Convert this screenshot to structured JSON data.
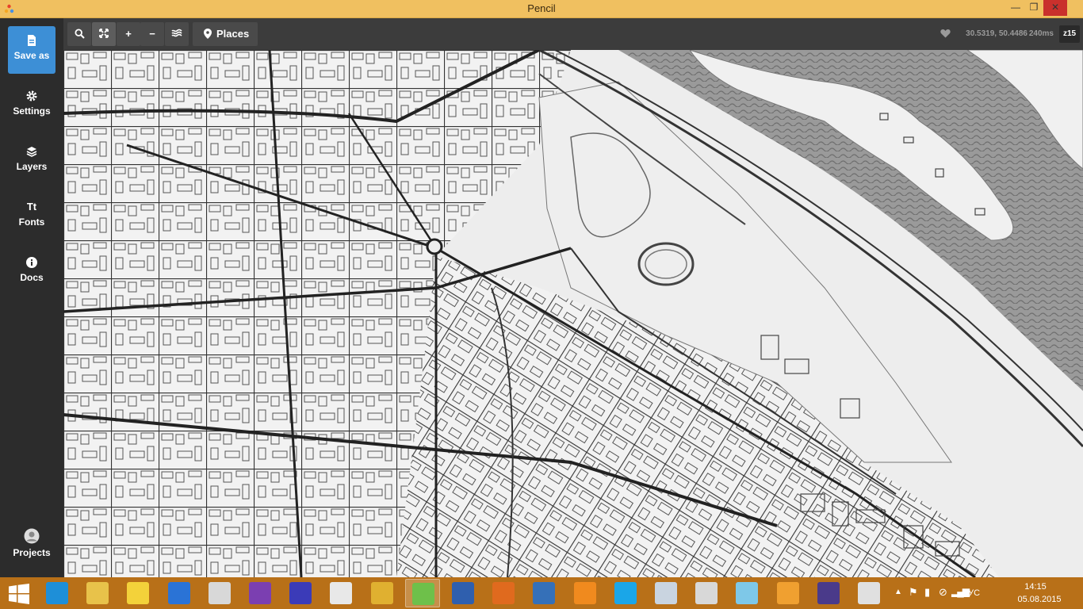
{
  "window": {
    "title": "Pencil",
    "min_glyph": "—",
    "max_glyph": "❐",
    "close_glyph": "✕"
  },
  "sidebar": {
    "items": [
      {
        "label": "Save as",
        "icon": "file-icon"
      },
      {
        "label": "Settings",
        "icon": "gear-icon"
      },
      {
        "label": "Layers",
        "icon": "layers-icon"
      },
      {
        "label": "Fonts",
        "icon": "fonts-icon",
        "glyph": "Tt"
      },
      {
        "label": "Docs",
        "icon": "info-icon"
      }
    ],
    "projects": {
      "label": "Projects",
      "icon": "avatar-icon"
    }
  },
  "toolbar": {
    "search_glyph": "⌕",
    "extent_glyph": "⤢",
    "zoom_in_glyph": "+",
    "zoom_out_glyph": "−",
    "places_label": "Places"
  },
  "status": {
    "coords": "30.5319, 50.4486",
    "render_time": "240ms",
    "zoom": "z15"
  },
  "colors": {
    "titlebar": "#f0c060",
    "sidebar": "#2c2c2c",
    "accent": "#3d8fd6",
    "toolbar": "#3c3c3c",
    "taskbar": "#b87018",
    "map_paper": "#efefef",
    "map_water": "#8a8a8a"
  },
  "taskbar": {
    "apps": [
      {
        "name": "internet-explorer",
        "color": "#1e8fd8"
      },
      {
        "name": "file-explorer",
        "color": "#e8c24a"
      },
      {
        "name": "1c",
        "color": "#f3d23a"
      },
      {
        "name": "teamviewer",
        "color": "#2a73d6"
      },
      {
        "name": "umlet",
        "color": "#d8d8d8"
      },
      {
        "name": "visual-studio",
        "color": "#7b3fb1"
      },
      {
        "name": "settings",
        "color": "#3b3bb8"
      },
      {
        "name": "code-editor",
        "color": "#e8e8e8"
      },
      {
        "name": "tools",
        "color": "#e0b030"
      },
      {
        "name": "calendar",
        "color": "#6ec04a"
      },
      {
        "name": "save-app",
        "color": "#2f5fae"
      },
      {
        "name": "firefox",
        "color": "#e06a1e"
      },
      {
        "name": "remote-desktop",
        "color": "#3570b8"
      },
      {
        "name": "pdf-app",
        "color": "#f08a1e"
      },
      {
        "name": "skype",
        "color": "#1aa6e8"
      },
      {
        "name": "calculator",
        "color": "#c9d4e0"
      },
      {
        "name": "umlet-2",
        "color": "#d8d8d8"
      },
      {
        "name": "notes",
        "color": "#7ec8e8"
      },
      {
        "name": "network-app",
        "color": "#f0a030"
      },
      {
        "name": "java-ee-ide",
        "color": "#4a3a8a"
      },
      {
        "name": "pencil-app",
        "color": "#e0e0e0"
      }
    ],
    "tray": {
      "language": "РУС",
      "time": "14:15",
      "date": "05.08.2015"
    }
  }
}
